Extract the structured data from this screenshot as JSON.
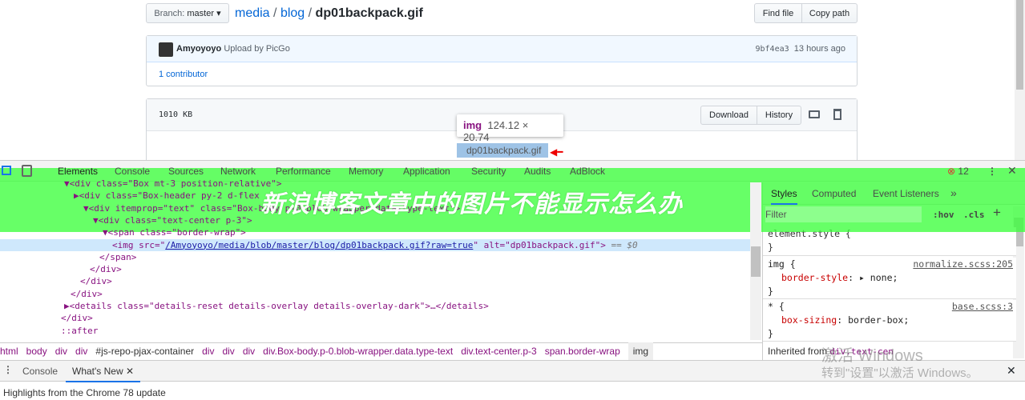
{
  "repo": {
    "branch_label": "Branch:",
    "branch": "master",
    "path": [
      {
        "text": "media"
      },
      {
        "text": "blog"
      }
    ],
    "file": "dp01backpack.gif",
    "sep": "/",
    "find_file": "Find file",
    "copy_path": "Copy path"
  },
  "commit": {
    "author": "Amyoyoyo",
    "message": "Upload by PicGo",
    "sha": "9bf4ea3",
    "time": "13 hours ago",
    "contributors": "1 contributor"
  },
  "file": {
    "size": "1010 KB",
    "download": "Download",
    "history": "History",
    "alt": "dp01backpack.gif"
  },
  "tooltip": {
    "tag": "img",
    "dims": "124.12 × 20.74"
  },
  "devtools": {
    "tabs": [
      "Elements",
      "Console",
      "Sources",
      "Network",
      "Performance",
      "Memory",
      "Application",
      "Security",
      "Audits",
      "AdBlock"
    ],
    "error_count": "12",
    "lines": [
      {
        "t": "▼<div class=\"Box mt-3 position-relative\">"
      },
      {
        "t": "▶<div class=\"Box-header py-2 d-flex"
      },
      {
        "t": "▼<div itemprop=\"text\" class=\"Box-body p-0 blob-wrapper data-type-text\">"
      },
      {
        "t": "▼<div class=\"text-center p-3\">"
      },
      {
        "t": "▼<span class=\"border-wrap\">"
      },
      {
        "a": "<img src=\"",
        "b": "/Amyoyoyo/media/blob/master/blog/dp01backpack.gif?raw=true",
        "c": "\" alt=\"dp01backpack.gif\">",
        "d": " == $0"
      },
      {
        "t": "</span>"
      },
      {
        "t": "</div>"
      },
      {
        "t": "</div>"
      },
      {
        "t": "</div>"
      },
      {
        "t": "▶<details class=\"details-reset details-overlay details-overlay-dark\">…</details>"
      },
      {
        "t": "</div>"
      },
      {
        "t": "::after"
      }
    ],
    "breadcrumbs": [
      "html",
      "body",
      "div",
      "div",
      "#js-repo-pjax-container",
      "div",
      "div",
      "div",
      "div.Box-body.p-0.blob-wrapper.data.type-text",
      "div.text-center.p-3",
      "span.border-wrap",
      "img"
    ],
    "styles_tabs": [
      "Styles",
      "Computed",
      "Event Listeners",
      "»"
    ],
    "filter_placeholder": "Filter",
    "hov": ":hov",
    "cls": ".cls",
    "plus": "+",
    "rules": {
      "element": "element.style {",
      "close": "}",
      "img_sel": "img {",
      "img_src": "normalize.scss:205",
      "img_prop": "border-style",
      "img_val": "none;",
      "star_sel": "* {",
      "star_src": "base.scss:3",
      "star_prop": "box-sizing",
      "star_val": "border-box;",
      "inherited": "Inherited from ",
      "inherited_sel": "div.text-cen"
    },
    "drawer_tabs": [
      "Console",
      "What's New"
    ],
    "drawer_text": "Highlights from the Chrome 78 update"
  },
  "banner": {
    "text": "新浪博客文章中的图片不能显示怎么办",
    "color": "#4dff4d"
  },
  "watermark": {
    "line1": "激活 Windows",
    "line2": "转到\"设置\"以激活 Windows。"
  }
}
